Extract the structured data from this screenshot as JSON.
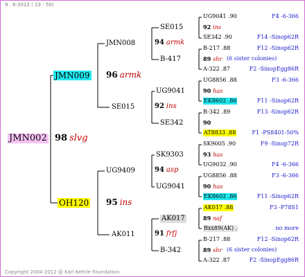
{
  "header": "9 . 6-2012 ( 23 : 50)",
  "footer": "Copyright 2004-2012 @ Karl Kehrle Foundation",
  "root": {
    "name": "JMN002"
  },
  "gen1": [
    {
      "name": "JMN009"
    },
    {
      "name": "OH120"
    }
  ],
  "gen1_nums": [
    {
      "num": "98",
      "code": "slvg"
    }
  ],
  "gen2": [
    {
      "name": "JMN008"
    },
    {
      "name": "SE015"
    },
    {
      "name": "UG9409"
    },
    {
      "name": "AK011"
    }
  ],
  "gen2_nums": [
    {
      "num": "96",
      "code": "armk"
    },
    {
      "num": "95",
      "code": "ins"
    }
  ],
  "gen3": [
    {
      "name": "SE015"
    },
    {
      "name": "B-417"
    },
    {
      "name": "UG9041"
    },
    {
      "name": "SE342"
    },
    {
      "name": "SK9303"
    },
    {
      "name": "UG9041"
    },
    {
      "name": "AK017"
    },
    {
      "name": "B-342"
    }
  ],
  "gen3_nums": [
    {
      "num": "94",
      "code": "armk"
    },
    {
      "num": "92",
      "code": "ins"
    },
    {
      "num": "94",
      "code": "asp"
    },
    {
      "num": "91",
      "code": "frfj"
    }
  ],
  "gen4": [
    {
      "name": "UG9041 .90",
      "note": "F4 -6-366"
    },
    {
      "name": "92",
      "code": "ins",
      "note": ""
    },
    {
      "name": "SE342 .90",
      "note": "F14 -Sinop62R"
    },
    {
      "name": "B-217 .88",
      "note": "F12 -Sinop62R"
    },
    {
      "name": "89",
      "code": "shr",
      "note": "(6 sister colonies)"
    },
    {
      "name": "A-322 .87",
      "note": "F2 -SinopEgg86R"
    },
    {
      "name": "UG8856 .88",
      "note": "F3 -6-366"
    },
    {
      "name": "90",
      "code": "has",
      "note": ""
    },
    {
      "name": "EK8602 .86",
      "note": "F11 -Sinop62R"
    },
    {
      "name": "B-342 .89",
      "note": "F13 -Sinop62R"
    },
    {
      "name": "90",
      "code": "",
      "note": ""
    },
    {
      "name": "AT8833 .88",
      "note": "F1 -PS8401-50%"
    },
    {
      "name": "SK9005 .90",
      "note": "F9 -Sinop72R"
    },
    {
      "name": "93",
      "code": "has",
      "note": ""
    },
    {
      "name": "UG9032 .90",
      "note": "F4 -6-366"
    },
    {
      "name": "UG8856 .88",
      "note": "F3 -6-366"
    },
    {
      "name": "90",
      "code": "has",
      "note": ""
    },
    {
      "name": "EK8602 .86",
      "note": "F11 -Sinop62R"
    },
    {
      "name": "AK017 .88",
      "note": "F3 -P78S1"
    },
    {
      "name": "89",
      "code": "naf",
      "note": ""
    },
    {
      "name": "Bxx89(AK) .",
      "note": "no more"
    },
    {
      "name": "B-217 .88",
      "note": "F12 -Sinop62R"
    },
    {
      "name": "89",
      "code": "shr",
      "note": "(6 sister colonies)"
    },
    {
      "name": "A-322 .87",
      "note": "F2 -SinopEgg86R"
    }
  ]
}
